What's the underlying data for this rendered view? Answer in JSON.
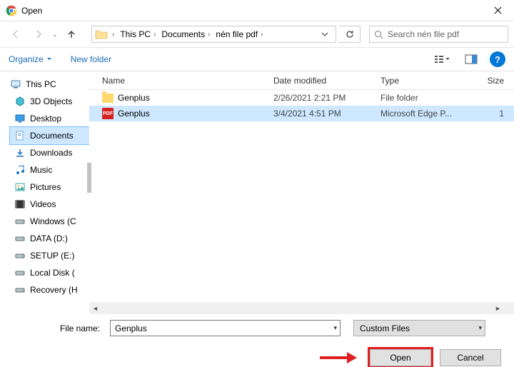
{
  "window": {
    "title": "Open"
  },
  "nav": {
    "segments": [
      "This PC",
      "Documents",
      "nén file pdf"
    ],
    "searchPlaceholder": "Search nén file pdf"
  },
  "toolbar": {
    "organize": "Organize",
    "newFolder": "New folder"
  },
  "tree": {
    "root": "This PC",
    "items": [
      "3D Objects",
      "Desktop",
      "Documents",
      "Downloads",
      "Music",
      "Pictures",
      "Videos",
      "Windows (C",
      "DATA (D:)",
      "SETUP (E:)",
      "Local Disk (",
      "Recovery (H"
    ],
    "selectedIndex": 2
  },
  "columns": {
    "name": "Name",
    "date": "Date modified",
    "type": "Type",
    "size": "Size"
  },
  "rows": [
    {
      "icon": "folder",
      "name": "Genplus",
      "date": "2/26/2021 2:21 PM",
      "type": "File folder",
      "size": "",
      "selected": false
    },
    {
      "icon": "pdf",
      "name": "Genplus",
      "date": "3/4/2021 4:51 PM",
      "type": "Microsoft Edge P...",
      "size": "1",
      "selected": true
    }
  ],
  "footer": {
    "fileNameLabel": "File name:",
    "fileNameValue": "Genplus",
    "filterValue": "Custom Files",
    "openLabel": "Open",
    "cancelLabel": "Cancel"
  }
}
